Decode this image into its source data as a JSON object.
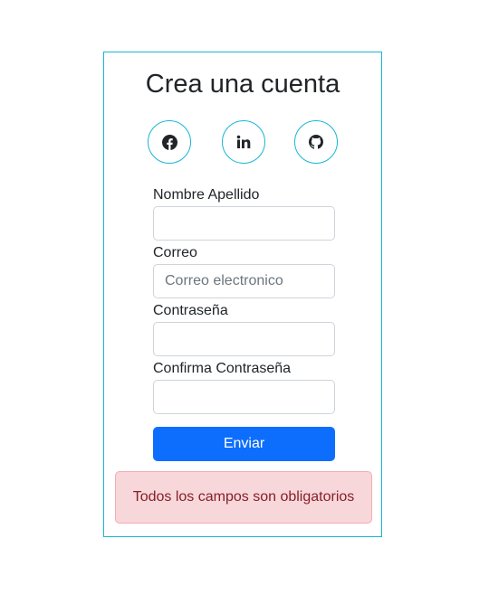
{
  "form": {
    "title": "Crea una cuenta",
    "social_buttons": [
      {
        "icon": "facebook-icon"
      },
      {
        "icon": "linkedin-icon"
      },
      {
        "icon": "github-icon"
      }
    ],
    "fields": {
      "name": {
        "label": "Nombre Apellido",
        "value": "",
        "placeholder": ""
      },
      "email": {
        "label": "Correo",
        "value": "",
        "placeholder": "Correo electronico"
      },
      "password": {
        "label": "Contraseña",
        "value": "",
        "placeholder": ""
      },
      "confirm_password": {
        "label": "Confirma Contraseña",
        "value": "",
        "placeholder": ""
      }
    },
    "submit_label": "Enviar",
    "error_message": "Todos los campos son obligatorios"
  },
  "colors": {
    "card_border": "#17b6d4",
    "primary": "#0d6efd",
    "alert_bg": "#f8d7da",
    "alert_text": "#842029"
  }
}
